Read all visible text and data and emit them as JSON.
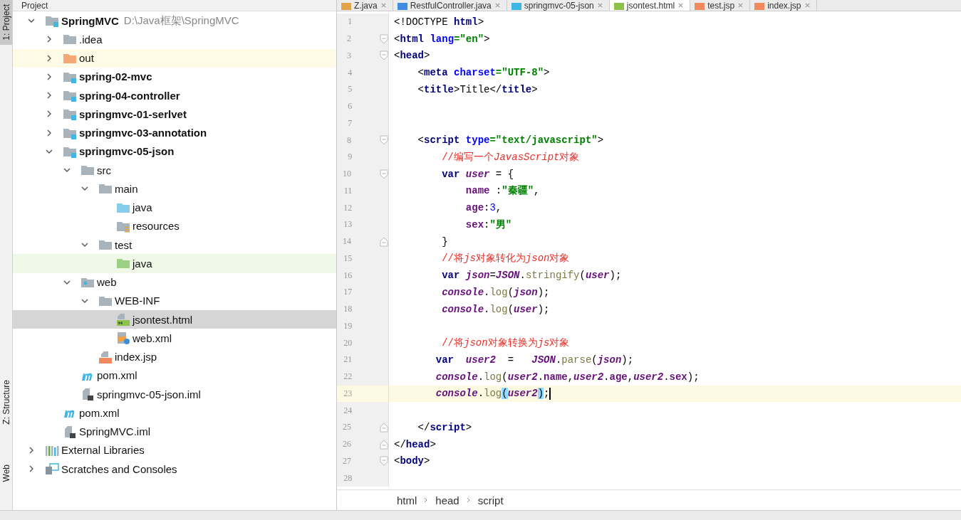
{
  "side_strip": [
    {
      "label": "1: Project",
      "selected": true,
      "kind": "project"
    },
    {
      "label": "Z: Structure",
      "selected": false,
      "kind": "structure"
    },
    {
      "label": "Web",
      "selected": false,
      "kind": "web"
    }
  ],
  "project_panel": {
    "title": "Project",
    "tree": [
      {
        "label": "SpringMVC",
        "path": "D:\\Java框架\\SpringMVC",
        "kind": "module",
        "bold": true,
        "expanded": true,
        "selected": false,
        "children": [
          {
            "label": ".idea",
            "kind": "folder",
            "bold": false,
            "expanded": false,
            "selected": false
          },
          {
            "label": "out",
            "kind": "excluded-folder",
            "bold": false,
            "expanded": false,
            "selected": false
          },
          {
            "label": "spring-02-mvc",
            "kind": "module",
            "bold": true,
            "expanded": false,
            "selected": false
          },
          {
            "label": "spring-04-controller",
            "kind": "module",
            "bold": true,
            "expanded": false,
            "selected": false
          },
          {
            "label": "springmvc-01-serlvet",
            "kind": "module",
            "bold": true,
            "expanded": false,
            "selected": false
          },
          {
            "label": "springmvc-03-annotation",
            "kind": "module",
            "bold": true,
            "expanded": false,
            "selected": false
          },
          {
            "label": "springmvc-05-json",
            "kind": "module",
            "bold": true,
            "expanded": true,
            "selected": false,
            "children": [
              {
                "label": "src",
                "kind": "folder",
                "bold": false,
                "expanded": true,
                "selected": false,
                "children": [
                  {
                    "label": "main",
                    "kind": "folder",
                    "bold": false,
                    "expanded": true,
                    "selected": false,
                    "children": [
                      {
                        "label": "java",
                        "kind": "source-folder",
                        "bold": false,
                        "selected": false
                      },
                      {
                        "label": "resources",
                        "kind": "resource-folder",
                        "bold": false,
                        "selected": false
                      }
                    ]
                  },
                  {
                    "label": "test",
                    "kind": "folder",
                    "bold": false,
                    "expanded": true,
                    "selected": false,
                    "children": [
                      {
                        "label": "java",
                        "kind": "test-folder",
                        "bold": false,
                        "selected": false
                      }
                    ]
                  }
                ]
              },
              {
                "label": "web",
                "kind": "web-folder",
                "bold": false,
                "expanded": true,
                "selected": false,
                "children": [
                  {
                    "label": "WEB-INF",
                    "kind": "folder",
                    "bold": false,
                    "expanded": true,
                    "selected": false,
                    "children": [
                      {
                        "label": "jsontest.html",
                        "kind": "html-file",
                        "bold": false,
                        "selected": true
                      },
                      {
                        "label": "web.xml",
                        "kind": "xml-file",
                        "bold": false,
                        "selected": false
                      }
                    ]
                  },
                  {
                    "label": "index.jsp",
                    "kind": "jsp-file",
                    "bold": false,
                    "selected": false
                  }
                ]
              },
              {
                "label": "pom.xml",
                "kind": "maven-file",
                "bold": false,
                "selected": false
              },
              {
                "label": "springmvc-05-json.iml",
                "kind": "iml-file",
                "bold": false,
                "selected": false
              }
            ]
          },
          {
            "label": "pom.xml",
            "kind": "maven-file",
            "bold": false,
            "selected": false
          },
          {
            "label": "SpringMVC.iml",
            "kind": "iml-file",
            "bold": false,
            "selected": false
          }
        ]
      },
      {
        "label": "External Libraries",
        "kind": "libraries",
        "bold": false,
        "expanded": false,
        "selected": false
      },
      {
        "label": "Scratches and Consoles",
        "kind": "scratches",
        "bold": false,
        "expanded": false,
        "selected": false
      }
    ]
  },
  "editor_tabs": [
    {
      "label": "Z.java",
      "kind": "java",
      "selected": false
    },
    {
      "label": "RestfulController.java",
      "kind": "class",
      "selected": false
    },
    {
      "label": "springmvc-05-json",
      "kind": "maven",
      "selected": false
    },
    {
      "label": "jsontest.html",
      "kind": "html",
      "selected": true
    },
    {
      "label": "test.jsp",
      "kind": "jsp",
      "selected": false
    },
    {
      "label": "index.jsp",
      "kind": "jsp",
      "selected": false
    }
  ],
  "code_lines": [
    {
      "number": "1",
      "kind": "plain",
      "current": false,
      "tokens": [
        {
          "kind": "plain",
          "text": "<!DOCTYPE "
        },
        {
          "kind": "tag",
          "text": "html"
        },
        {
          "kind": "plain",
          "text": ">"
        }
      ]
    },
    {
      "number": "2",
      "kind": "fold-start",
      "current": false,
      "tokens": [
        {
          "kind": "plain",
          "text": "<"
        },
        {
          "kind": "tag",
          "text": "html"
        },
        {
          "kind": "attr",
          "text": " lang"
        },
        {
          "kind": "string",
          "text": "=\"en\""
        },
        {
          "kind": "plain",
          "text": ">"
        }
      ]
    },
    {
      "number": "3",
      "kind": "fold-start",
      "current": false,
      "tokens": [
        {
          "kind": "plain",
          "text": "<"
        },
        {
          "kind": "tag",
          "text": "head"
        },
        {
          "kind": "plain",
          "text": ">"
        }
      ]
    },
    {
      "number": "4",
      "kind": "plain",
      "current": false,
      "tokens": [
        {
          "kind": "plain",
          "text": "    <"
        },
        {
          "kind": "tag",
          "text": "meta"
        },
        {
          "kind": "attr",
          "text": " charset"
        },
        {
          "kind": "string",
          "text": "=\"UTF-8\""
        },
        {
          "kind": "plain",
          "text": ">"
        }
      ]
    },
    {
      "number": "5",
      "kind": "plain",
      "current": false,
      "tokens": [
        {
          "kind": "plain",
          "text": "    <"
        },
        {
          "kind": "tag",
          "text": "title"
        },
        {
          "kind": "plain",
          "text": ">Title</"
        },
        {
          "kind": "tag",
          "text": "title"
        },
        {
          "kind": "plain",
          "text": ">"
        }
      ]
    },
    {
      "number": "6",
      "kind": "plain",
      "current": false
    },
    {
      "number": "7",
      "kind": "plain",
      "current": false
    },
    {
      "number": "8",
      "kind": "fold-start",
      "current": false,
      "tokens": [
        {
          "kind": "plain",
          "text": "    <"
        },
        {
          "kind": "tag",
          "text": "script"
        },
        {
          "kind": "attr",
          "text": " type"
        },
        {
          "kind": "string",
          "text": "=\"text/javascript\""
        },
        {
          "kind": "plain",
          "text": ">"
        }
      ]
    },
    {
      "number": "9",
      "kind": "plain",
      "current": false,
      "tokens": [
        {
          "kind": "comment",
          "text": "        //编写一个"
        },
        {
          "kind": "comment-italic",
          "text": "JavasScript"
        },
        {
          "kind": "comment",
          "text": "对象"
        }
      ]
    },
    {
      "number": "10",
      "kind": "fold-start",
      "current": false,
      "tokens": [
        {
          "kind": "keyword",
          "text": "        var"
        },
        {
          "kind": "variable",
          "text": " user"
        },
        {
          "kind": "plain",
          "text": " = {"
        }
      ]
    },
    {
      "number": "11",
      "kind": "plain",
      "current": false,
      "tokens": [
        {
          "kind": "property",
          "text": "            name"
        },
        {
          "kind": "plain",
          "text": " :"
        },
        {
          "kind": "string",
          "text": "\"秦疆\""
        },
        {
          "kind": "plain",
          "text": ","
        }
      ]
    },
    {
      "number": "12",
      "kind": "plain",
      "current": false,
      "tokens": [
        {
          "kind": "property",
          "text": "            age"
        },
        {
          "kind": "plain",
          "text": ":"
        },
        {
          "kind": "number",
          "text": "3"
        },
        {
          "kind": "plain",
          "text": ","
        }
      ]
    },
    {
      "number": "13",
      "kind": "plain",
      "current": false,
      "tokens": [
        {
          "kind": "property",
          "text": "            sex"
        },
        {
          "kind": "plain",
          "text": ":"
        },
        {
          "kind": "string",
          "text": "\"男\""
        }
      ]
    },
    {
      "number": "14",
      "kind": "fold-end",
      "current": false,
      "tokens": [
        {
          "kind": "plain",
          "text": "        }"
        }
      ]
    },
    {
      "number": "15",
      "kind": "plain",
      "current": false,
      "tokens": [
        {
          "kind": "comment",
          "text": "        //将"
        },
        {
          "kind": "comment-italic",
          "text": "js"
        },
        {
          "kind": "comment",
          "text": "对象转化为"
        },
        {
          "kind": "comment-italic",
          "text": "json"
        },
        {
          "kind": "comment",
          "text": "对象"
        }
      ]
    },
    {
      "number": "16",
      "kind": "plain",
      "current": false,
      "tokens": [
        {
          "kind": "keyword",
          "text": "        var"
        },
        {
          "kind": "variable",
          "text": " json"
        },
        {
          "kind": "plain",
          "text": "="
        },
        {
          "kind": "variable",
          "text": "JSON"
        },
        {
          "kind": "plain",
          "text": "."
        },
        {
          "kind": "function",
          "text": "stringify"
        },
        {
          "kind": "plain",
          "text": "("
        },
        {
          "kind": "variable",
          "text": "user"
        },
        {
          "kind": "plain",
          "text": ");"
        }
      ]
    },
    {
      "number": "17",
      "kind": "plain",
      "current": false,
      "tokens": [
        {
          "kind": "variable",
          "text": "        console"
        },
        {
          "kind": "plain",
          "text": "."
        },
        {
          "kind": "function",
          "text": "log"
        },
        {
          "kind": "plain",
          "text": "("
        },
        {
          "kind": "variable",
          "text": "json"
        },
        {
          "kind": "plain",
          "text": ");"
        }
      ]
    },
    {
      "number": "18",
      "kind": "plain",
      "current": false,
      "tokens": [
        {
          "kind": "variable",
          "text": "        console"
        },
        {
          "kind": "plain",
          "text": "."
        },
        {
          "kind": "function",
          "text": "log"
        },
        {
          "kind": "plain",
          "text": "("
        },
        {
          "kind": "variable",
          "text": "user"
        },
        {
          "kind": "plain",
          "text": ");"
        }
      ]
    },
    {
      "number": "19",
      "kind": "plain",
      "current": false
    },
    {
      "number": "20",
      "kind": "plain",
      "current": false,
      "tokens": [
        {
          "kind": "comment",
          "text": "        //将"
        },
        {
          "kind": "comment-italic",
          "text": "json"
        },
        {
          "kind": "comment",
          "text": "对象转换为"
        },
        {
          "kind": "comment-italic",
          "text": "js"
        },
        {
          "kind": "comment",
          "text": "对象"
        }
      ]
    },
    {
      "number": "21",
      "kind": "plain",
      "current": false,
      "tokens": [
        {
          "kind": "keyword",
          "text": "       var"
        },
        {
          "kind": "variable",
          "text": "  user2"
        },
        {
          "kind": "plain",
          "text": "  =   "
        },
        {
          "kind": "variable",
          "text": "JSON"
        },
        {
          "kind": "plain",
          "text": "."
        },
        {
          "kind": "function",
          "text": "parse"
        },
        {
          "kind": "plain",
          "text": "("
        },
        {
          "kind": "variable",
          "text": "json"
        },
        {
          "kind": "plain",
          "text": ");"
        }
      ]
    },
    {
      "number": "22",
      "kind": "plain",
      "current": false,
      "tokens": [
        {
          "kind": "variable",
          "text": "       console"
        },
        {
          "kind": "plain",
          "text": "."
        },
        {
          "kind": "function",
          "text": "log"
        },
        {
          "kind": "plain",
          "text": "("
        },
        {
          "kind": "variable",
          "text": "user2"
        },
        {
          "kind": "plain",
          "text": "."
        },
        {
          "kind": "property",
          "text": "name"
        },
        {
          "kind": "plain",
          "text": ","
        },
        {
          "kind": "variable",
          "text": "user2"
        },
        {
          "kind": "plain",
          "text": "."
        },
        {
          "kind": "property",
          "text": "age"
        },
        {
          "kind": "plain",
          "text": ","
        },
        {
          "kind": "variable",
          "text": "user2"
        },
        {
          "kind": "plain",
          "text": "."
        },
        {
          "kind": "property",
          "text": "sex"
        },
        {
          "kind": "plain",
          "text": ");"
        }
      ]
    },
    {
      "number": "23",
      "kind": "plain",
      "current": true,
      "tokens": [
        {
          "kind": "variable",
          "text": "       console"
        },
        {
          "kind": "plain",
          "text": "."
        },
        {
          "kind": "function",
          "text": "log"
        },
        {
          "kind": "brace-match",
          "text": "("
        },
        {
          "kind": "variable",
          "text": "user2"
        },
        {
          "kind": "brace-match",
          "text": ")"
        },
        {
          "kind": "plain",
          "text": ";"
        }
      ]
    },
    {
      "number": "24",
      "kind": "plain",
      "current": false
    },
    {
      "number": "25",
      "kind": "fold-end",
      "current": false,
      "tokens": [
        {
          "kind": "plain",
          "text": "    </"
        },
        {
          "kind": "tag",
          "text": "script"
        },
        {
          "kind": "plain",
          "text": ">"
        }
      ]
    },
    {
      "number": "26",
      "kind": "fold-end",
      "current": false,
      "tokens": [
        {
          "kind": "plain",
          "text": "</"
        },
        {
          "kind": "tag",
          "text": "head"
        },
        {
          "kind": "plain",
          "text": ">"
        }
      ]
    },
    {
      "number": "27",
      "kind": "fold-start",
      "current": false,
      "tokens": [
        {
          "kind": "plain",
          "text": "<"
        },
        {
          "kind": "tag",
          "text": "body"
        },
        {
          "kind": "plain",
          "text": ">"
        }
      ]
    },
    {
      "number": "28",
      "kind": "plain",
      "current": false
    }
  ],
  "breadcrumbs": [
    "html",
    "head",
    "script"
  ]
}
